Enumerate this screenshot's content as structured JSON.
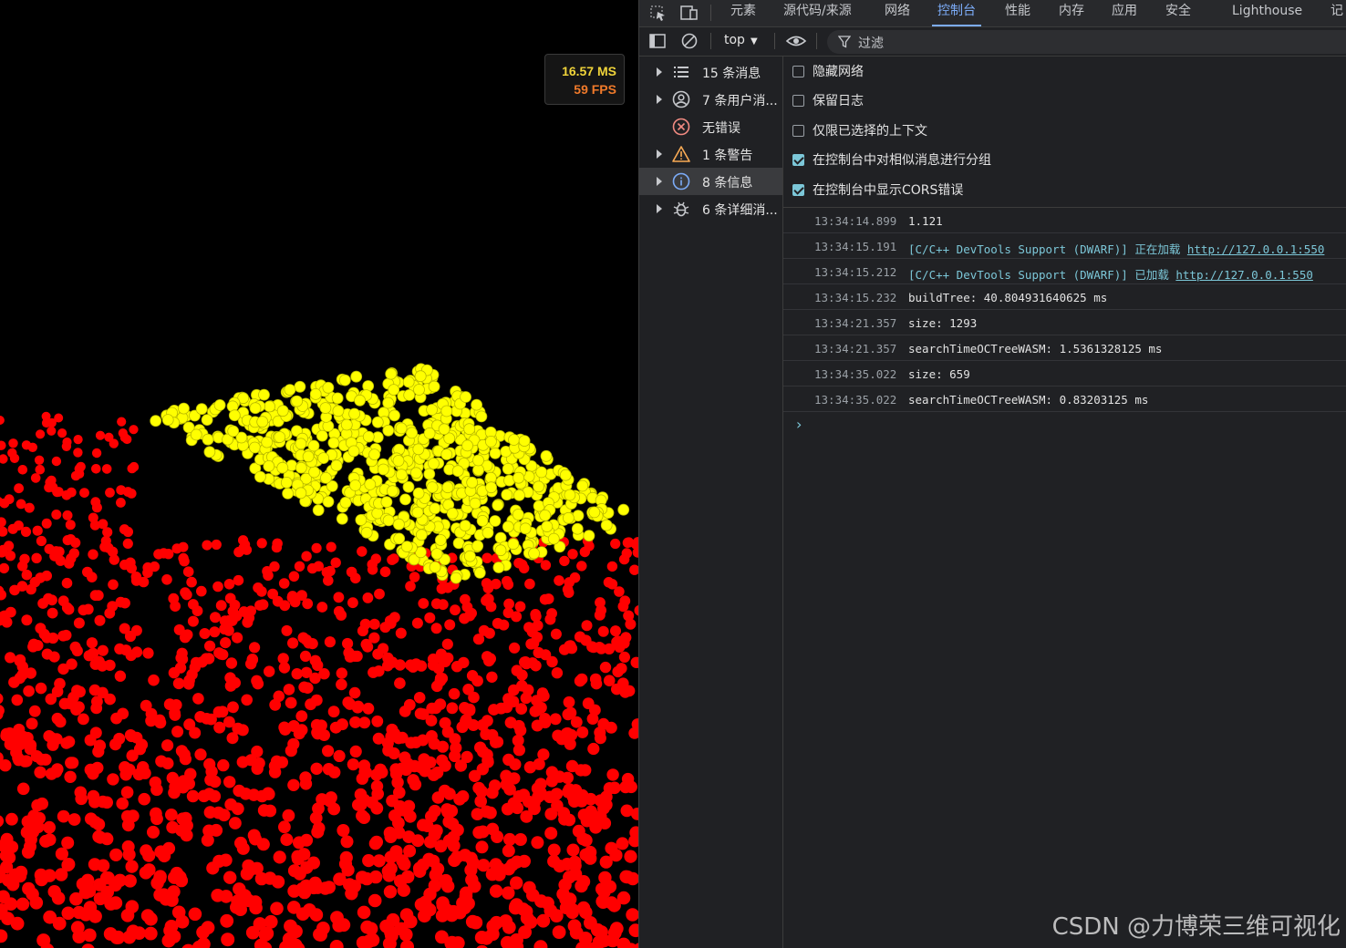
{
  "stats": {
    "ms": "16.57 MS",
    "fps": "59 FPS"
  },
  "points": {
    "base_color": "#ff0000",
    "highlight_color": "#ffff00"
  },
  "devtools": {
    "tabs": [
      {
        "label": "元素"
      },
      {
        "label": "源代码/来源"
      },
      {
        "label": "网络"
      },
      {
        "label": "控制台",
        "active": true
      },
      {
        "label": "性能"
      },
      {
        "label": "内存"
      },
      {
        "label": "应用"
      },
      {
        "label": "安全"
      },
      {
        "label": "Lighthouse"
      },
      {
        "label": "记"
      }
    ],
    "toolbar": {
      "context": "top",
      "filter_placeholder": "过滤"
    },
    "sidebar": [
      {
        "label": "15 条消息",
        "icon": "list-icon",
        "expandable": true
      },
      {
        "label": "7 条用户消...",
        "icon": "user-icon",
        "expandable": true
      },
      {
        "label": "无错误",
        "icon": "error-icon",
        "expandable": false
      },
      {
        "label": "1 条警告",
        "icon": "warning-icon",
        "expandable": true
      },
      {
        "label": "8 条信息",
        "icon": "info-icon",
        "expandable": true,
        "selected": true
      },
      {
        "label": "6 条详细消...",
        "icon": "bug-icon",
        "expandable": true
      }
    ],
    "options": [
      {
        "label": "隐藏网络",
        "checked": false
      },
      {
        "label": "保留日志",
        "checked": false
      },
      {
        "label": "仅限已选择的上下文",
        "checked": false
      },
      {
        "label": "在控制台中对相似消息进行分组",
        "checked": true
      },
      {
        "label": "在控制台中显示CORS错误",
        "checked": true
      }
    ],
    "log": [
      {
        "time": "13:34:14.899",
        "text": "1.121"
      },
      {
        "time": "13:34:15.191",
        "text": "[C/C++ DevTools Support (DWARF)] 正在加载 ",
        "link": "http://127.0.0.1:550",
        "style": "cyan"
      },
      {
        "time": "13:34:15.212",
        "text": "[C/C++ DevTools Support (DWARF)] 已加载 ",
        "link": "http://127.0.0.1:550",
        "style": "cyan"
      },
      {
        "time": "13:34:15.232",
        "text": "buildTree: 40.804931640625 ms"
      },
      {
        "time": "13:34:21.357",
        "text": "size: 1293"
      },
      {
        "time": "13:34:21.357",
        "text": "searchTimeOCTreeWASM: 1.5361328125 ms"
      },
      {
        "time": "13:34:35.022",
        "text": "size: 659"
      },
      {
        "time": "13:34:35.022",
        "text": "searchTimeOCTreeWASM: 0.83203125 ms"
      }
    ],
    "prompt": "›"
  },
  "watermark": "CSDN @力博荣三维可视化"
}
